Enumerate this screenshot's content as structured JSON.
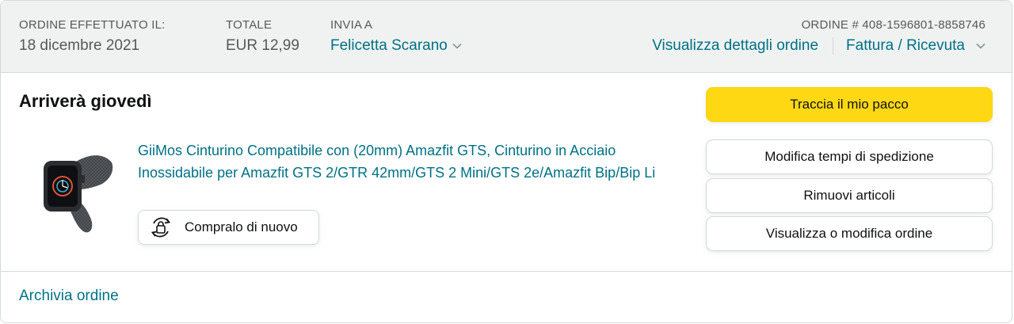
{
  "header": {
    "order_placed_label": "ORDINE EFFETTUATO IL:",
    "order_placed_value": "18 dicembre 2021",
    "total_label": "TOTALE",
    "total_value": "EUR 12,99",
    "ship_to_label": "INVIA A",
    "ship_to_value": "Felicetta Scarano",
    "order_number": "ORDINE # 408-1596801-8858746",
    "view_details": "Visualizza dettagli ordine",
    "invoice": "Fattura / Ricevuta"
  },
  "shipment": {
    "status": "Arriverà giovedì",
    "product_title": "GiiMos Cinturino Compatibile con (20mm) Amazfit GTS, Cinturino in Acciaio Inossidabile per Amazfit GTS 2/GTR 42mm/GTS 2 Mini/GTS 2e/Amazfit Bip/Bip Li",
    "buy_again": "Compralo di nuovo"
  },
  "actions": {
    "track": "Traccia il mio pacco",
    "change_delivery": "Modifica tempi di spedizione",
    "remove_items": "Rimuovi articoli",
    "view_edit": "Visualizza o modifica ordine"
  },
  "footer": {
    "archive": "Archivia ordine"
  },
  "colors": {
    "link": "#007185",
    "primary_button": "#FFD814",
    "header_bg": "#F0F2F2"
  }
}
